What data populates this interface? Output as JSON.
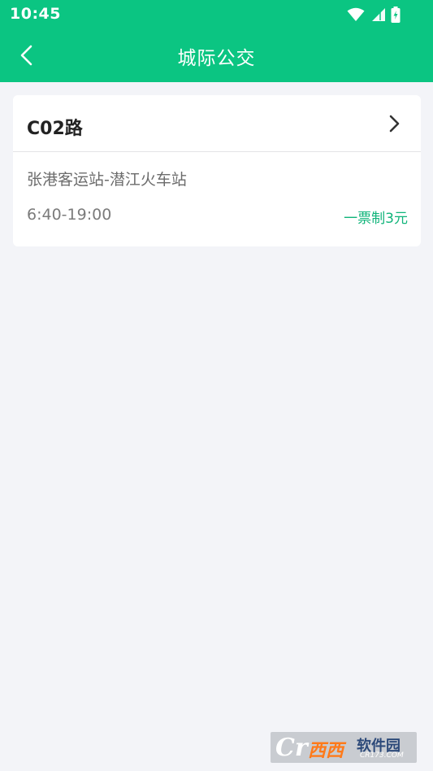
{
  "status_bar": {
    "time": "10:45",
    "icons": [
      "wifi-icon",
      "signal-icon",
      "battery-charging-icon"
    ]
  },
  "header": {
    "title": "城际公交",
    "back_icon": "chevron-left-icon",
    "background_color": "#0bc582"
  },
  "route_card": {
    "route_name": "C02路",
    "stations": "张港客运站-潜江火车站",
    "hours": "6:40-19:00",
    "fare": "一票制3元",
    "fare_color": "#10b47a",
    "detail_icon": "chevron-right-icon"
  },
  "watermark": {
    "brand": "西西软件园",
    "logo_mark": "Cr",
    "site": "CR173.COM"
  }
}
